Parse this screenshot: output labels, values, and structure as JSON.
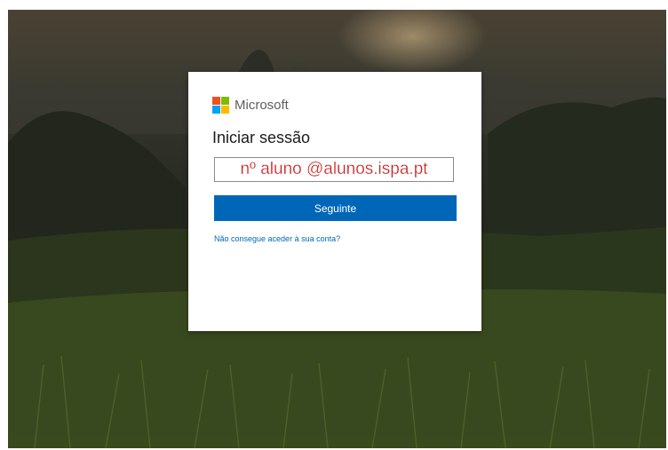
{
  "brand": {
    "name": "Microsoft",
    "logo_colors": [
      "#f25022",
      "#7fba00",
      "#00a4ef",
      "#ffb900"
    ]
  },
  "signin": {
    "title": "Iniciar sessão",
    "email_value": "nº aluno @alunos.ispa.pt",
    "next_label": "Seguinte",
    "cant_access_link": "Não consegue aceder à sua conta?"
  },
  "colors": {
    "accent": "#0067b8",
    "email_text": "#d01818"
  }
}
